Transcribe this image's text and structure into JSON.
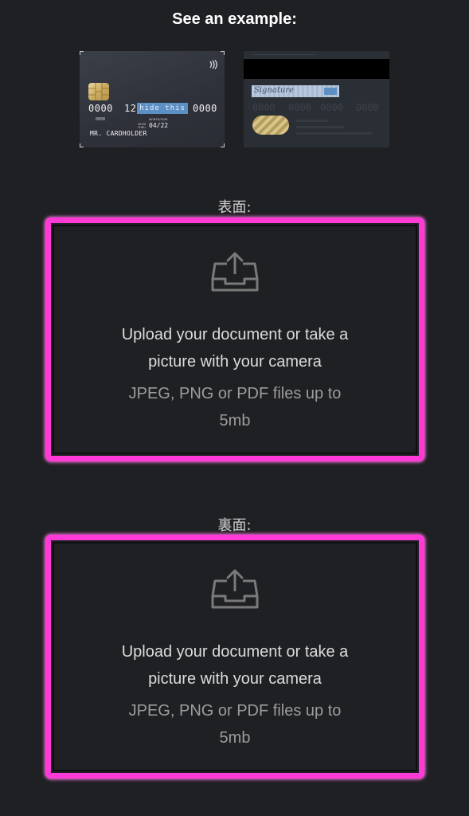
{
  "header": {
    "title": "See an example:"
  },
  "example_front": {
    "number_group_1": "0000",
    "number_group_2": "12",
    "hide_label": "hide this",
    "number_group_4": "0000",
    "small_number": "0000",
    "month_year_label": "MONTH/YEAR",
    "valid_thru_label_1": "VALID",
    "valid_thru_label_2": "THRU",
    "expiry": "04/22",
    "cardholder": "MR. CARDHOLDER",
    "contactless_icon": "contactless-icon"
  },
  "example_back": {
    "signature": "Signature",
    "ghost_numbers": [
      "0000",
      "0000",
      "0000",
      "0000"
    ]
  },
  "uploads": [
    {
      "side_label": "表面:",
      "main_line_1": "Upload your document or take a",
      "main_line_2": "picture with your camera",
      "sub_line_1": "JPEG, PNG or PDF files up to",
      "sub_line_2": "5mb",
      "icon": "upload-tray-icon"
    },
    {
      "side_label": "裏面:",
      "main_line_1": "Upload your document or take a",
      "main_line_2": "picture with your camera",
      "sub_line_1": "JPEG, PNG or PDF files up to",
      "sub_line_2": "5mb",
      "icon": "upload-tray-icon"
    }
  ],
  "colors": {
    "background": "#1f2023",
    "dropzone_border": "#ff3ad6",
    "hide_box": "#5c8fc3"
  }
}
